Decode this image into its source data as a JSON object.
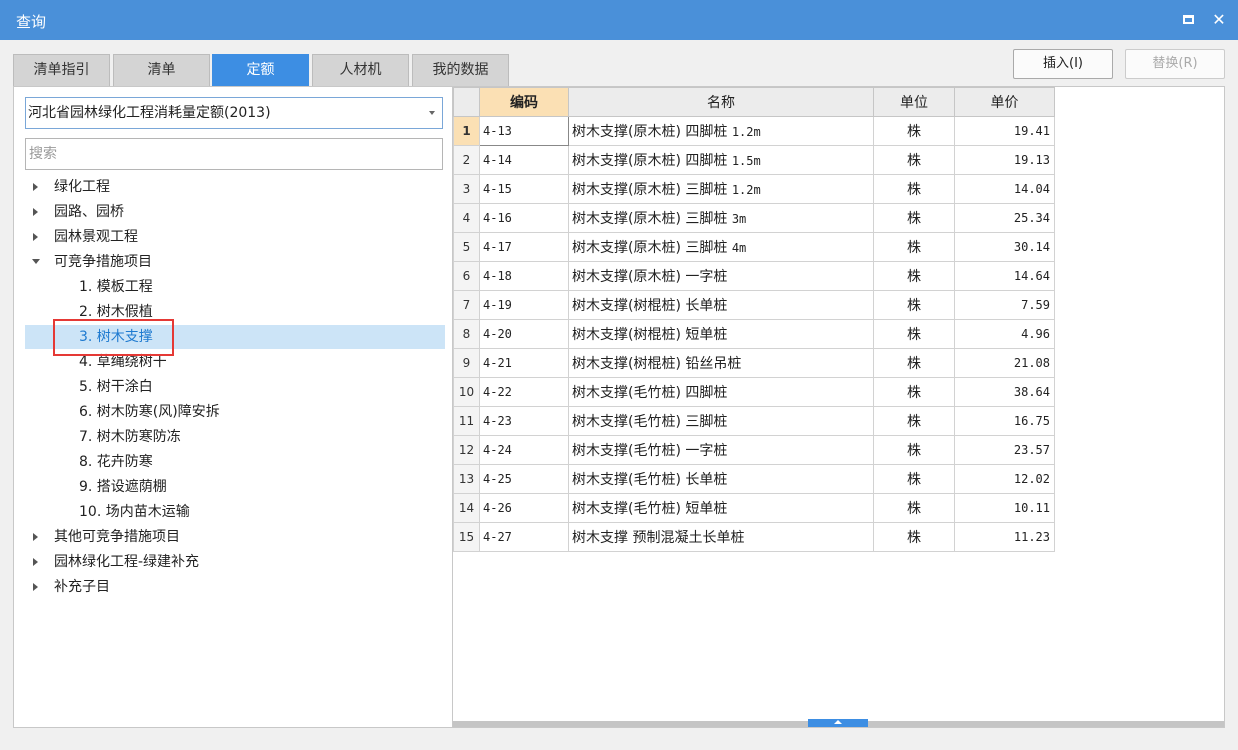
{
  "window": {
    "title": "查询"
  },
  "tabs": [
    {
      "label": "清单指引"
    },
    {
      "label": "清单"
    },
    {
      "label": "定额",
      "active": true
    },
    {
      "label": "人材机"
    },
    {
      "label": "我的数据"
    }
  ],
  "buttons": {
    "insert": "插入(I)",
    "replace": "替换(R)"
  },
  "library": {
    "selected": "河北省园林绿化工程消耗量定额(2013)"
  },
  "search": {
    "placeholder": "搜索",
    "value": ""
  },
  "tree": [
    {
      "label": "绿化工程",
      "level": 0,
      "expanded": false
    },
    {
      "label": "园路、园桥",
      "level": 0,
      "expanded": false
    },
    {
      "label": "园林景观工程",
      "level": 0,
      "expanded": false
    },
    {
      "label": "可竞争措施项目",
      "level": 0,
      "expanded": true
    },
    {
      "label": "1. 模板工程",
      "level": 1
    },
    {
      "label": "2. 树木假植",
      "level": 1
    },
    {
      "label": "3. 树木支撑",
      "level": 1,
      "selected": true
    },
    {
      "label": "4. 草绳绕树干",
      "level": 1
    },
    {
      "label": "5. 树干涂白",
      "level": 1
    },
    {
      "label": "6. 树木防寒(风)障安拆",
      "level": 1
    },
    {
      "label": "7. 树木防寒防冻",
      "level": 1
    },
    {
      "label": "8. 花卉防寒",
      "level": 1
    },
    {
      "label": "9. 搭设遮荫棚",
      "level": 1
    },
    {
      "label": "10. 场内苗木运输",
      "level": 1
    },
    {
      "label": "其他可竞争措施项目",
      "level": 0,
      "expanded": false
    },
    {
      "label": "园林绿化工程-绿建补充",
      "level": 0,
      "expanded": false
    },
    {
      "label": "补充子目",
      "level": 0,
      "expanded": false
    }
  ],
  "table": {
    "columns": [
      "编码",
      "名称",
      "单位",
      "单价"
    ],
    "rows": [
      {
        "n": "1",
        "code": "4-13",
        "name": "树木支撑(原木桩) 四脚桩",
        "spec": "1.2m",
        "unit": "株",
        "price": "19.41"
      },
      {
        "n": "2",
        "code": "4-14",
        "name": "树木支撑(原木桩) 四脚桩",
        "spec": "1.5m",
        "unit": "株",
        "price": "19.13"
      },
      {
        "n": "3",
        "code": "4-15",
        "name": "树木支撑(原木桩) 三脚桩",
        "spec": "1.2m",
        "unit": "株",
        "price": "14.04"
      },
      {
        "n": "4",
        "code": "4-16",
        "name": "树木支撑(原木桩) 三脚桩",
        "spec": "3m",
        "unit": "株",
        "price": "25.34"
      },
      {
        "n": "5",
        "code": "4-17",
        "name": "树木支撑(原木桩) 三脚桩",
        "spec": "4m",
        "unit": "株",
        "price": "30.14"
      },
      {
        "n": "6",
        "code": "4-18",
        "name": "树木支撑(原木桩) 一字桩",
        "spec": "",
        "unit": "株",
        "price": "14.64"
      },
      {
        "n": "7",
        "code": "4-19",
        "name": "树木支撑(树棍桩) 长单桩",
        "spec": "",
        "unit": "株",
        "price": "7.59"
      },
      {
        "n": "8",
        "code": "4-20",
        "name": "树木支撑(树棍桩) 短单桩",
        "spec": "",
        "unit": "株",
        "price": "4.96"
      },
      {
        "n": "9",
        "code": "4-21",
        "name": "树木支撑(树棍桩) 铅丝吊桩",
        "spec": "",
        "unit": "株",
        "price": "21.08"
      },
      {
        "n": "10",
        "code": "4-22",
        "name": "树木支撑(毛竹桩) 四脚桩",
        "spec": "",
        "unit": "株",
        "price": "38.64"
      },
      {
        "n": "11",
        "code": "4-23",
        "name": "树木支撑(毛竹桩) 三脚桩",
        "spec": "",
        "unit": "株",
        "price": "16.75"
      },
      {
        "n": "12",
        "code": "4-24",
        "name": "树木支撑(毛竹桩) 一字桩",
        "spec": "",
        "unit": "株",
        "price": "23.57"
      },
      {
        "n": "13",
        "code": "4-25",
        "name": "树木支撑(毛竹桩) 长单桩",
        "spec": "",
        "unit": "株",
        "price": "12.02"
      },
      {
        "n": "14",
        "code": "4-26",
        "name": "树木支撑(毛竹桩) 短单桩",
        "spec": "",
        "unit": "株",
        "price": "10.11"
      },
      {
        "n": "15",
        "code": "4-27",
        "name": "树木支撑 预制混凝土长单桩",
        "spec": "",
        "unit": "株",
        "price": "11.23"
      }
    ]
  },
  "colors": {
    "titlebar": "#4a90d9",
    "active_tab": "#3d8ee3",
    "header_highlight": "#fbe0b4",
    "selection": "#cce4f7",
    "annotation_box": "#e53935"
  }
}
